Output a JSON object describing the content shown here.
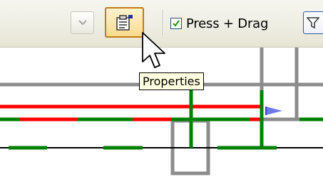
{
  "toolbar": {
    "dropdown_icon": "chevron-down-icon",
    "properties_icon": "properties-icon",
    "press_drag_label": "Press + Drag",
    "press_drag_checked": true,
    "filter_icon": "filter-icon"
  },
  "tooltip": {
    "text": "Properties"
  },
  "colors": {
    "track_red": "#ff0000",
    "track_green": "#008000",
    "track_gray": "#8c8c8c",
    "track_black": "#000000",
    "signal_blue": "#6b78f0",
    "button_highlight": "#fcd98e",
    "tooltip_bg": "#ffffe1"
  }
}
